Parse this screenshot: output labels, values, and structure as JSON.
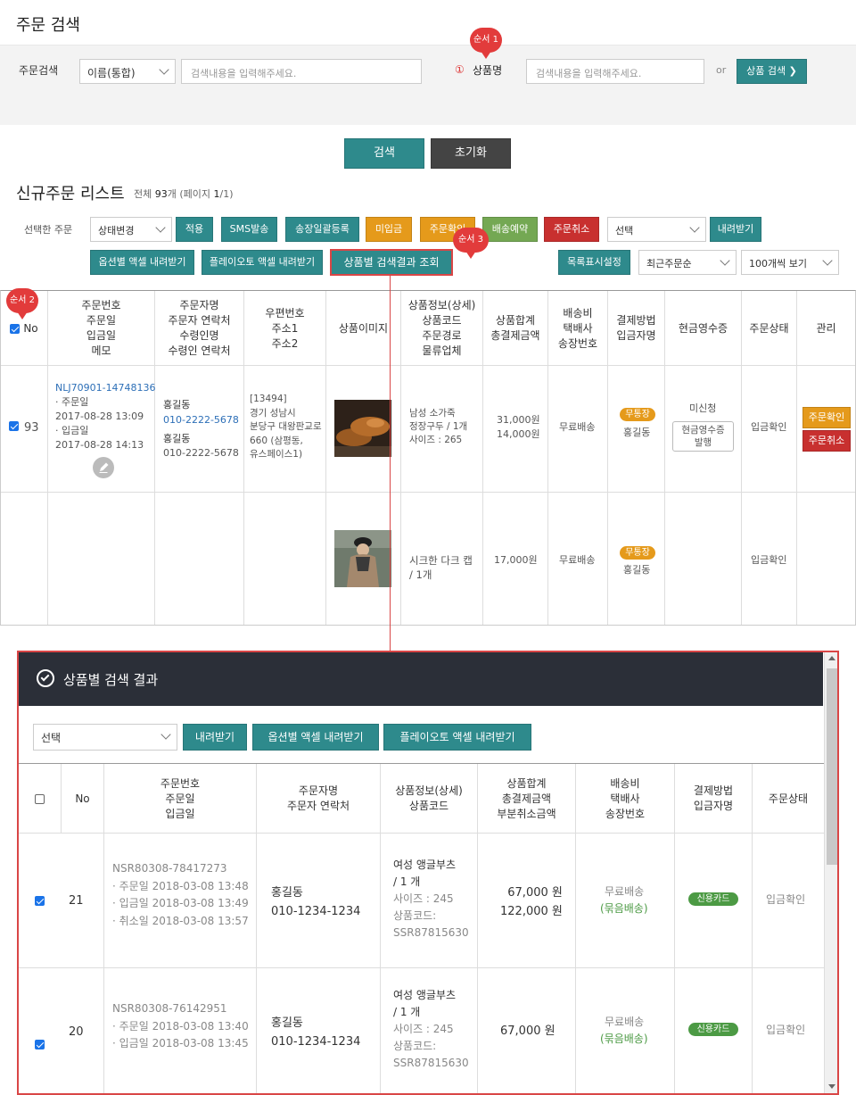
{
  "page_title": "주문 검색",
  "search": {
    "label": "주문검색",
    "type_select": "이름(통합)",
    "input_placeholder": "검색내용을 입력해주세요.",
    "step_num": "①",
    "product_label": "상품명",
    "product_placeholder": "검색내용을 입력해주세요.",
    "or_text": "or",
    "product_search_btn": "상품 검색 ❯",
    "search_btn": "검색",
    "reset_btn": "초기화"
  },
  "badges": {
    "b1": "순서 1",
    "b2": "순서 2",
    "b3": "순서 3"
  },
  "list": {
    "title": "신규주문 리스트",
    "count_pre": "전체 ",
    "count_num": "93",
    "count_mid": "개 (페이지 ",
    "page_cur": "1",
    "page_rest": "/1)"
  },
  "toolbar": {
    "selected_label": "선택한 주문",
    "status_select": "상태변경",
    "apply": "적용",
    "sms": "SMS발송",
    "invoice": "송장일괄등록",
    "unpaid": "미입금",
    "order_confirm": "주문확인",
    "ship_reserve": "배송예약",
    "order_cancel": "주문취소",
    "select2": "선택",
    "download": "내려받기",
    "opt_excel": "옵션별 액셀 내려받기",
    "playauto_excel": "플레이오토 액셀 내려받기",
    "product_result": "상품별 검색결과 조회",
    "list_setting": "목록표시설정",
    "sort_select": "최근주문순",
    "per_page_select": "100개씩 보기"
  },
  "table": {
    "headers": [
      "No",
      "주문번호\n주문일\n입금일\n메모",
      "주문자명\n주문자 연락처\n수령인명\n수령인 연락처",
      "우편번호\n주소1\n주소2",
      "상품이미지",
      "상품정보(상세)\n상품코드\n주문경로\n물류업체",
      "상품합계\n총결제금액",
      "배송비\n택배사\n송장번호",
      "결제방법\n입금자명",
      "현금영수증",
      "주문상태",
      "관리"
    ],
    "row1": {
      "no": "93",
      "order_no": "NLJ70901-14748136",
      "dates": "· 주문일\n   2017-08-28 13:09\n· 입금일\n   2017-08-28 14:13",
      "buyer": "홍길동",
      "buyer_phone": "010-2222-5678",
      "receiver": "홍길동",
      "receiver_phone": "010-2222-5678",
      "address": "[13494]\n경기 성남시\n분당구 대왕판교로\n660 (삼평동,\n유스페이스1)",
      "product": "남성 소가죽\n정장구두 / 1개\n사이즈 : 265",
      "amount": "31,000원\n14,000원",
      "shipping": "무료배송",
      "pay_badge": "무통장",
      "payer": "홍길동",
      "receipt_status": "미신청",
      "receipt_btn": "현금영수증\n발행",
      "status": "입금확인",
      "manage_confirm": "주문확인",
      "manage_cancel": "주문취소"
    },
    "row2": {
      "product": "시크한 다크 캡\n/ 1개",
      "amount": "17,000원",
      "shipping": "무료배송",
      "pay_badge": "무통장",
      "payer": "홍길동",
      "status": "입금확인"
    }
  },
  "popup": {
    "title": "상품별 검색 결과",
    "select": "선택",
    "download": "내려받기",
    "opt_excel": "옵션별 액셀 내려받기",
    "playauto_excel": "플레이오토 액셀 내려받기",
    "headers": [
      "No",
      "주문번호\n주문일\n입금일",
      "주문자명\n주문자 연락처",
      "상품정보(상세)\n상품코드",
      "상품합계\n총결제금액\n부분취소금액",
      "배송비\n택배사\n송장번호",
      "결제방법\n입금자명",
      "주문상태"
    ],
    "rows": [
      {
        "no": "21",
        "order": "NSR80308-78417273\n· 주문일 2018-03-08 13:48\n· 입금일 2018-03-08 13:49\n· 취소일 2018-03-08 13:57",
        "buyer": "홍길동\n010-1234-1234",
        "product": "여성 앵글부츠\n/ 1 개",
        "product_sub": "사이즈 : 245\n상품코드:\nSSR87815630",
        "amount": "67,000 원\n122,000 원",
        "shipping": "무료배송",
        "bundle": "(묶음배송)",
        "pay": "신용카드",
        "status": "입금확인"
      },
      {
        "no": "20",
        "order": "NSR80308-76142951\n· 주문일 2018-03-08 13:40\n· 입금일 2018-03-08 13:45",
        "buyer": "홍길동\n010-1234-1234",
        "product": "여성 앵글부츠\n/ 1 개",
        "product_sub": "사이즈 : 245\n상품코드:\nSSR87815630",
        "amount": "67,000 원",
        "shipping": "무료배송",
        "bundle": "(묶음배송)",
        "pay": "신용카드",
        "status": "입금확인"
      }
    ]
  },
  "colors": {
    "teal": "#2e8a8c",
    "red_badge": "#e23b3b",
    "orange": "#e59a1b",
    "green": "#74a853",
    "popup_border": "#d94646",
    "popup_header": "#2b2f38"
  }
}
